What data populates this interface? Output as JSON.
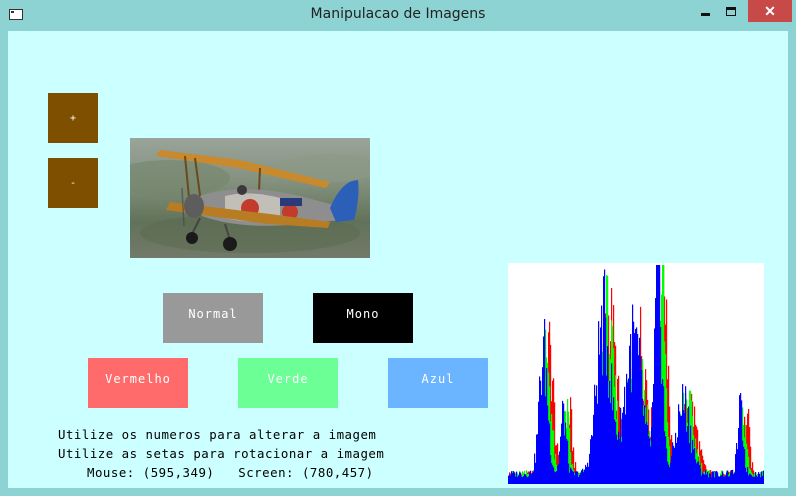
{
  "window": {
    "title": "Manipulacao de Imagens",
    "close_glyph": "✕",
    "icons": [
      "app-window-icon",
      "minimize-icon",
      "maximize-icon",
      "close-icon"
    ]
  },
  "zoom": {
    "plus_label": "+",
    "minus_label": "-"
  },
  "modes": {
    "normal": "Normal",
    "mono": "Mono",
    "red": "Vermelho",
    "green": "Verde",
    "blue": "Azul"
  },
  "image": {
    "description_icon": "airplane-photo"
  },
  "info": {
    "line1": "Utilize os numeros para alterar a imagem",
    "line2": "Utilize as setas para rotacionar a imagem",
    "mouse_label": "Mouse:",
    "mouse_value": "(595,349)",
    "screen_label": "Screen:",
    "screen_value": "(780,457)"
  },
  "colors": {
    "zoom_button": "#7f4f00",
    "normal": "#999999",
    "mono": "#000000",
    "red": "#ff6b6b",
    "green": "#6bff95",
    "blue": "#6bb4ff",
    "client_bg": "#ccffff",
    "hist_red": "#ff0000",
    "hist_green": "#00ff00",
    "hist_blue": "#0000ff"
  }
}
